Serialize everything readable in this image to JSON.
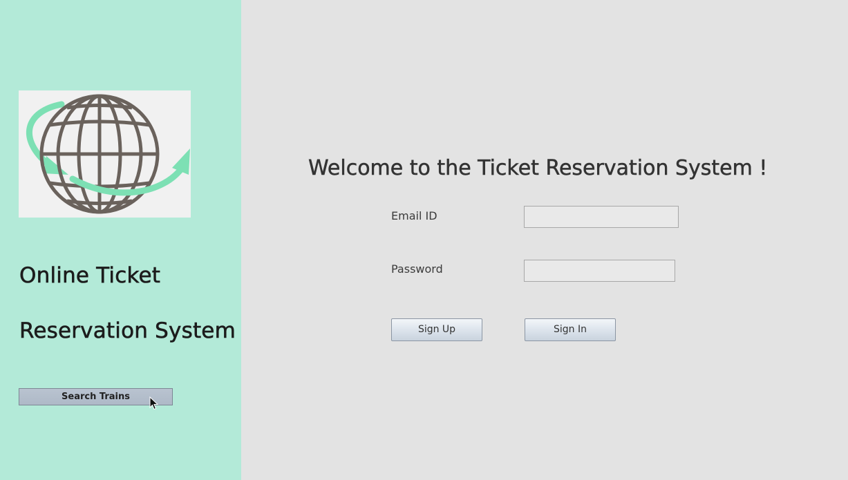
{
  "sidebar": {
    "logo_icon": "globe-with-arrows-icon",
    "title_line1": "Online Ticket",
    "title_line2": "Reservation System",
    "search_button_label": "Search Trains"
  },
  "main": {
    "welcome_text": "Welcome to the Ticket Reservation System !",
    "email_label": "Email ID",
    "email_value": "",
    "password_label": "Password",
    "password_value": "",
    "signup_label": "Sign Up",
    "signin_label": "Sign In"
  },
  "colors": {
    "sidebar_bg": "#b3ead8",
    "main_bg": "#e3e3e3",
    "logo_arrow": "#7de0b4",
    "logo_globe": "#6a625c"
  }
}
